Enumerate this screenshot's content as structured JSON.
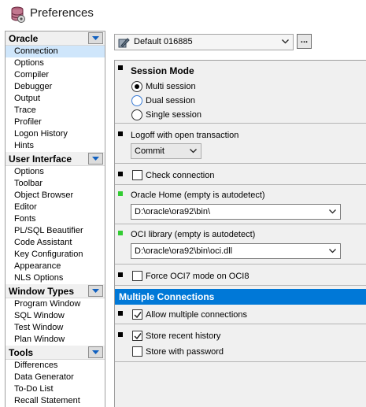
{
  "window": {
    "title": "Preferences"
  },
  "sidebar": {
    "groups": [
      {
        "label": "Oracle",
        "items": [
          "Connection",
          "Options",
          "Compiler",
          "Debugger",
          "Output",
          "Trace",
          "Profiler",
          "Logon History",
          "Hints"
        ]
      },
      {
        "label": "User Interface",
        "items": [
          "Options",
          "Toolbar",
          "Object Browser",
          "Editor",
          "Fonts",
          "PL/SQL Beautifier",
          "Code Assistant",
          "Key Configuration",
          "Appearance",
          "NLS Options"
        ]
      },
      {
        "label": "Window Types",
        "items": [
          "Program Window",
          "SQL Window",
          "Test Window",
          "Plan Window"
        ]
      },
      {
        "label": "Tools",
        "items": [
          "Differences",
          "Data Generator",
          "To-Do List",
          "Recall Statement"
        ]
      }
    ],
    "selected": "Connection"
  },
  "profile": {
    "value": "Default 016885",
    "more_label": "..."
  },
  "session_mode": {
    "title": "Session Mode",
    "options": [
      "Multi session",
      "Dual session",
      "Single session"
    ],
    "selected": "Multi session"
  },
  "logoff": {
    "label": "Logoff with open transaction",
    "value": "Commit"
  },
  "check_connection": {
    "label": "Check connection",
    "checked": false
  },
  "oracle_home": {
    "label": "Oracle Home (empty is autodetect)",
    "value": "D:\\oracle\\ora92\\bin\\"
  },
  "oci_library": {
    "label": "OCI library (empty is autodetect)",
    "value": "D:\\oracle\\ora92\\bin\\oci.dll"
  },
  "force_oci7": {
    "label": "Force OCI7 mode on OCI8",
    "checked": false
  },
  "multiple_connections": {
    "header": "Multiple Connections",
    "allow": {
      "label": "Allow multiple connections",
      "checked": true
    }
  },
  "history": {
    "store_recent": {
      "label": "Store recent history",
      "checked": true
    },
    "store_password": {
      "label": "Store with password",
      "checked": false
    }
  },
  "colors": {
    "accent": "#0078d7",
    "selection": "#cfe6fb",
    "marker_green": "#33cc33"
  }
}
